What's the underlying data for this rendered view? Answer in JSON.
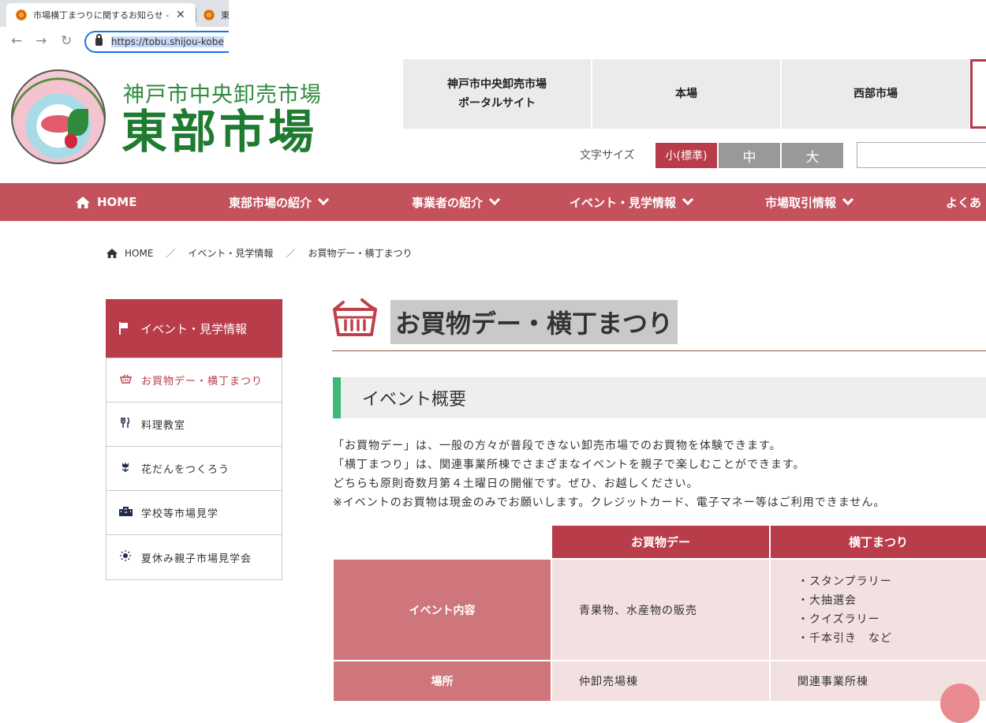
{
  "browser": {
    "tab_title": "市場横丁まつりに関するお知らせ - 神",
    "tab2_title": "東",
    "url": "https://tobu.shijou-kobe"
  },
  "header": {
    "site_sub": "神戸市中央卸売市場",
    "site_main": "東部市場",
    "top_links": [
      "神戸市中央卸売市場\nポータルサイト",
      "本場",
      "西部市場"
    ],
    "font_size_label": "文字サイズ",
    "font_sizes": [
      "小(標準)",
      "中",
      "大"
    ]
  },
  "nav": {
    "home": "HOME",
    "items": [
      "東部市場の紹介",
      "事業者の紹介",
      "イベント・見学情報",
      "市場取引情報",
      "よくあ"
    ]
  },
  "breadcrumb": [
    "HOME",
    "イベント・見学情報",
    "お買物デー・横丁まつり"
  ],
  "sidebar": {
    "heading": "イベント・見学情報",
    "items": [
      {
        "label": "お買物デー・横丁まつり",
        "icon": "basket-icon"
      },
      {
        "label": "料理教室",
        "icon": "fork-knife-icon"
      },
      {
        "label": "花だんをつくろう",
        "icon": "flower-icon"
      },
      {
        "label": "学校等市場見学",
        "icon": "building-icon"
      },
      {
        "label": "夏休み親子市場見学会",
        "icon": "sun-icon"
      }
    ]
  },
  "main": {
    "title": "お買物デー・横丁まつり",
    "section_heading": "イベント概要",
    "description": [
      "「お買物デー」は、一般の方々が普段できない卸売市場でのお買物を体験できます。",
      "「横丁まつり」は、関連事業所棟でさまざまなイベントを親子で楽しむことができます。",
      "どちらも原則奇数月第４土曜日の開催です。ぜひ、お越しください。",
      "※イベントのお買物は現金のみでお願いします。クレジットカード、電子マネー等はご利用できません。"
    ],
    "table": {
      "columns": [
        "お買物デー",
        "横丁まつり"
      ],
      "rows": [
        {
          "head": "イベント内容",
          "col1": "青果物、水産物の販売",
          "col2": [
            "・スタンプラリー",
            "・大抽選会",
            "・クイズラリー",
            "・千本引き　など"
          ]
        },
        {
          "head": "場所",
          "col1": "仲卸売場棟",
          "col2": "関連事業所棟"
        }
      ]
    }
  },
  "colors": {
    "accent": "#b83c49",
    "nav": "#c4525d",
    "brand_green": "#1e7b2f",
    "section_bar": "#3cb878"
  }
}
